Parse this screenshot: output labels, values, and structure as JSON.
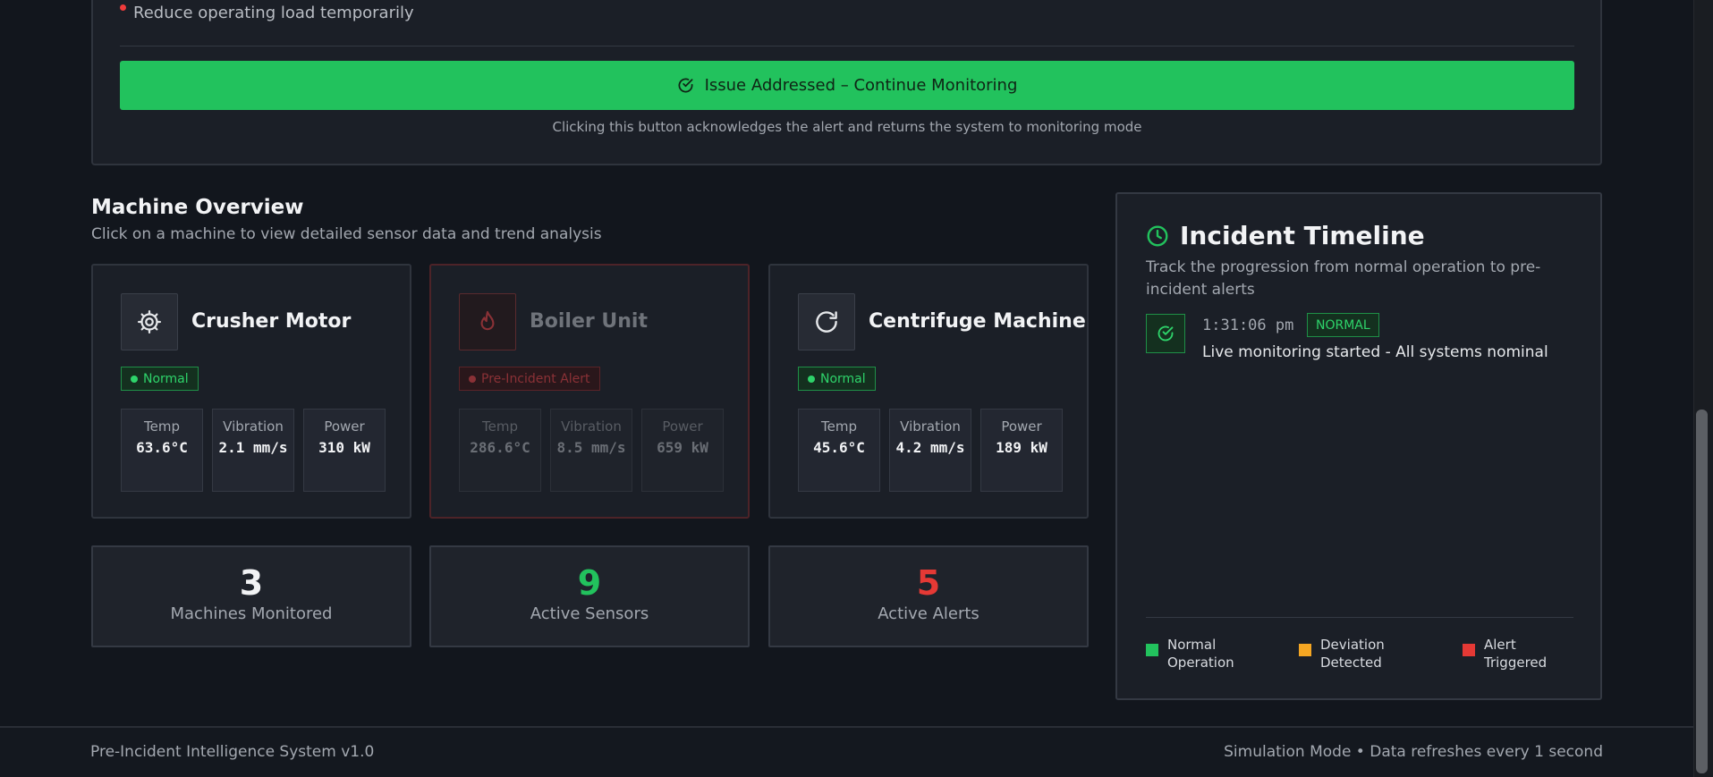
{
  "alert": {
    "action_item": "Reduce operating load temporarily",
    "ack_button_label": "Issue Addressed – Continue Monitoring",
    "ack_hint": "Clicking this button acknowledges the alert and returns the system to monitoring mode"
  },
  "overview": {
    "title": "Machine Overview",
    "subtitle": "Click on a machine to view detailed sensor data and trend analysis",
    "machines": [
      {
        "name": "Crusher Motor",
        "icon": "gear-icon",
        "status": "Normal",
        "metrics": [
          {
            "label": "Temp",
            "value": "63.6°C"
          },
          {
            "label": "Vibration",
            "value": "2.1 mm/s"
          },
          {
            "label": "Power",
            "value": "310 kW"
          }
        ]
      },
      {
        "name": "Boiler Unit",
        "icon": "flame-icon",
        "status": "Pre-Incident Alert",
        "metrics": [
          {
            "label": "Temp",
            "value": "286.6°C"
          },
          {
            "label": "Vibration",
            "value": "8.5 mm/s"
          },
          {
            "label": "Power",
            "value": "659 kW"
          }
        ]
      },
      {
        "name": "Centrifuge Machine",
        "icon": "refresh-icon",
        "status": "Normal",
        "metrics": [
          {
            "label": "Temp",
            "value": "45.6°C"
          },
          {
            "label": "Vibration",
            "value": "4.2 mm/s"
          },
          {
            "label": "Power",
            "value": "189 kW"
          }
        ]
      }
    ],
    "stats": [
      {
        "value": "3",
        "label": "Machines Monitored"
      },
      {
        "value": "9",
        "label": "Active Sensors"
      },
      {
        "value": "5",
        "label": "Active Alerts"
      }
    ]
  },
  "timeline": {
    "title": "Incident Timeline",
    "subtitle": "Track the progression from normal operation to pre-incident alerts",
    "events": [
      {
        "time": "1:31:06 pm",
        "badge": "NORMAL",
        "text": "Live monitoring started - All systems nominal"
      }
    ],
    "legend": [
      {
        "label": "Normal Operation",
        "color": "#22c25d"
      },
      {
        "label": "Deviation Detected",
        "color": "#f5a623"
      },
      {
        "label": "Alert Triggered",
        "color": "#e53935"
      }
    ]
  },
  "footer": {
    "left": "Pre-Incident Intelligence System v1.0",
    "right": "Simulation Mode • Data refreshes every 1 second"
  },
  "colors": {
    "accent": "#22c25d",
    "alert": "#e53935",
    "warning": "#f5a623",
    "background": "#12161d",
    "panel": "#1b1f27"
  }
}
